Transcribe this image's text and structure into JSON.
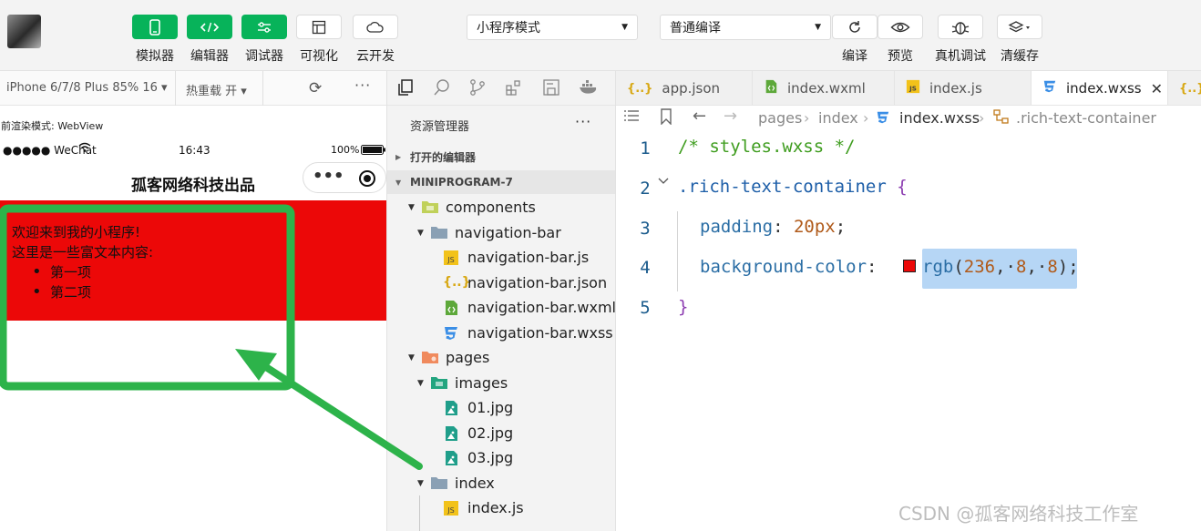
{
  "toolbar": {
    "buttons": [
      {
        "label": "模拟器",
        "icon": "phone-icon"
      },
      {
        "label": "编辑器",
        "icon": "code-brackets-icon"
      },
      {
        "label": "调试器",
        "icon": "sliders-icon"
      },
      {
        "label": "可视化",
        "icon": "layout-icon"
      },
      {
        "label": "云开发",
        "icon": "cloud-icon"
      }
    ],
    "mode_select": "小程序模式",
    "compile_select": "普通编译",
    "right_buttons": [
      {
        "label": "编译",
        "icon": "refresh-icon"
      },
      {
        "label": "预览",
        "icon": "eye-icon"
      },
      {
        "label": "真机调试",
        "icon": "bug-icon"
      },
      {
        "label": "清缓存",
        "icon": "layers-icon"
      }
    ]
  },
  "simulator": {
    "device": "iPhone 6/7/8 Plus 85% 16",
    "hot_reload": "热重载 开",
    "render_mode": "当前渲染模式: WebView",
    "carrier": "●●●●● WeChat",
    "time": "16:43",
    "battery": "100%",
    "nav_title": "孤客网络科技出品",
    "content_line1": "欢迎来到我的小程序!",
    "content_line2": "这里是一些富文本内容:",
    "list_items": [
      "第一项",
      "第二项"
    ],
    "block_color": "#ec0808"
  },
  "explorer": {
    "title": "资源管理器",
    "more": "···",
    "open_editors": "打开的编辑器",
    "project": "MINIPROGRAM-7",
    "tree": {
      "components": "components",
      "navigation_bar": "navigation-bar",
      "nav_js": "navigation-bar.js",
      "nav_json": "navigation-bar.json",
      "nav_wxml": "navigation-bar.wxml",
      "nav_wxss": "navigation-bar.wxss",
      "pages": "pages",
      "images": "images",
      "img1": "01.jpg",
      "img2": "02.jpg",
      "img3": "03.jpg",
      "index": "index",
      "index_js": "index.js"
    }
  },
  "editor": {
    "tabs": [
      {
        "label": "app.json",
        "icon": "{..}"
      },
      {
        "label": "index.wxml",
        "icon": "<>"
      },
      {
        "label": "index.js",
        "icon": "JS"
      },
      {
        "label": "index.wxss",
        "icon": "3"
      }
    ],
    "breadcrumb": {
      "p1": "pages",
      "p2": "index",
      "p3": "index.wxss",
      "p4": ".rich-text-container"
    },
    "line_numbers": [
      "1",
      "2",
      "3",
      "4",
      "5"
    ],
    "code": {
      "l1": "/* styles.wxss */",
      "l2_sel": ".rich-text-container",
      "l2_brace": "{",
      "l3_prop": "padding",
      "l3_val": "20px",
      "l4_prop": "background-color",
      "l4_fn": "rgb",
      "l4_a": "236",
      "l4_b": "8",
      "l4_c": "8",
      "l5": "}"
    }
  },
  "watermark": "CSDN @孤客网络科技工作室"
}
